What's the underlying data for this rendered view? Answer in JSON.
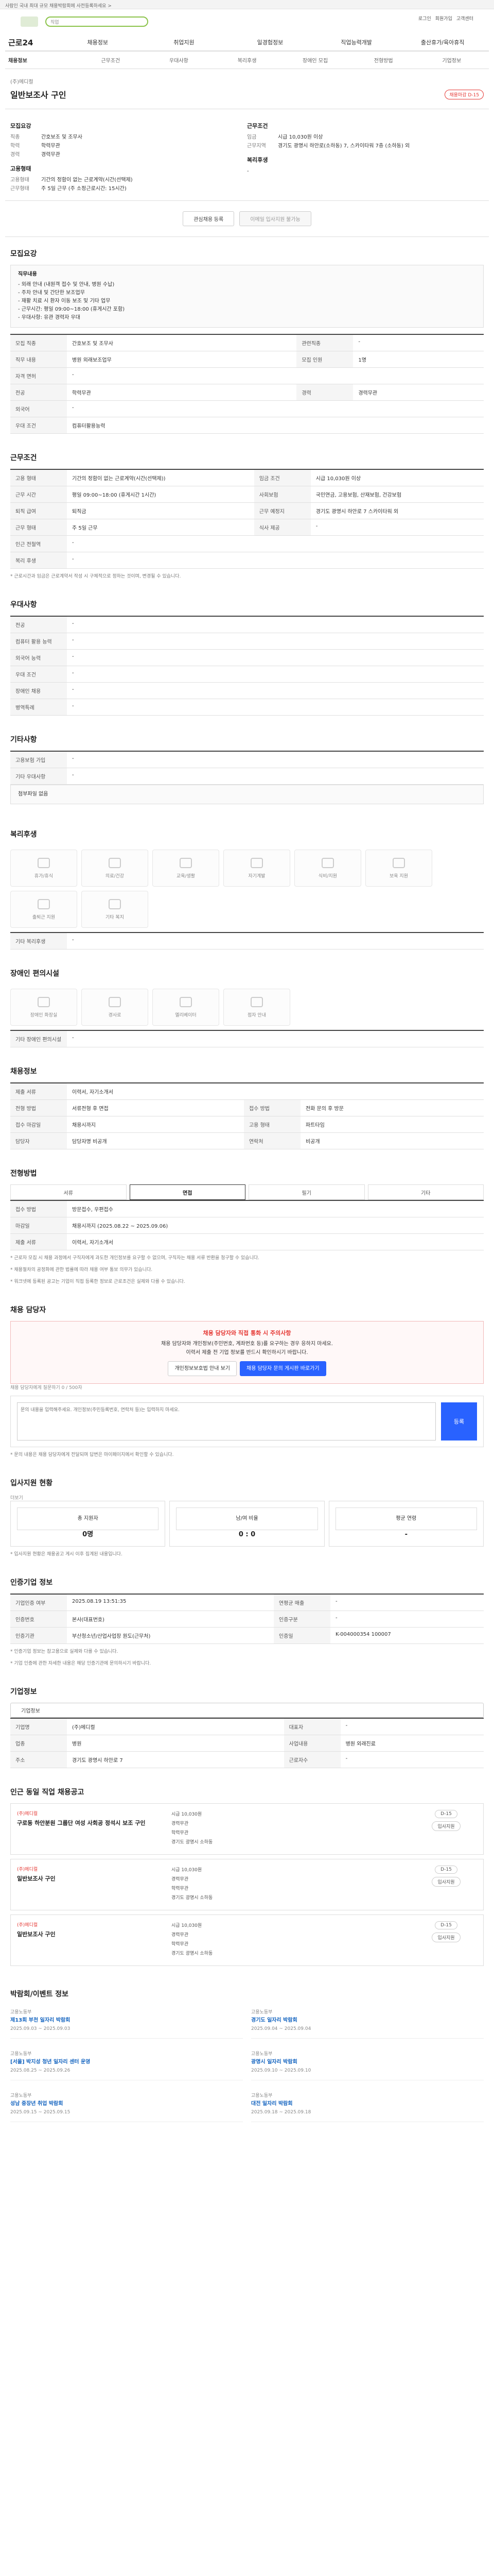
{
  "topbar": {
    "notice": "사람인 국내 최대 규모 채용박람회에 사전등록하세요 >"
  },
  "search": {
    "placeholder": "직업",
    "util": [
      "로그인",
      "회원가입",
      "고객센터"
    ]
  },
  "gnb": {
    "brand": "근로24",
    "items": [
      "채용정보",
      "취업지원",
      "일경험정보",
      "직업능력개발",
      "출산휴가/육아휴직"
    ]
  },
  "tabs": [
    "채용정보",
    "근무조건",
    "우대사항",
    "복리후생",
    "장애인 모집",
    "전형방법",
    "기업정보"
  ],
  "job": {
    "company": "(주)메디컬",
    "title": "일반보조사 구인",
    "dday": "채용마감 D-15"
  },
  "recruit": {
    "heading": "모집요강",
    "items": [
      {
        "k": "직종",
        "v": "간호보조 및 조무사"
      },
      {
        "k": "학력",
        "v": "학력무관"
      },
      {
        "k": "경력",
        "v": "경력무관"
      }
    ]
  },
  "cond": {
    "heading": "근무조건",
    "items": [
      {
        "k": "임금",
        "v": "시급 10,030원 이상"
      },
      {
        "k": "근무지역",
        "v": "경기도 광명시 하안로(소하동) 7, 스카이타워 7층 (소하동) 외"
      }
    ]
  },
  "employ": {
    "heading": "고용형태",
    "items": [
      {
        "k": "고용형태",
        "v": "기간의 정함이 없는 근로계약(시간(선택제)"
      },
      {
        "k": "근무형태",
        "v": "주 5일 근무 (주 소정근로시간: 15시간)"
      }
    ]
  },
  "welfare_top": {
    "heading": "복리후생",
    "v": "-"
  },
  "buttons": {
    "scrap": "관심채용 등록",
    "apply": "이메일 입사지원 불가능"
  },
  "s1": {
    "heading": "모집요강",
    "box_title": "직무내용",
    "box_lines": [
      "- 외래 안내 (내원객 접수 및 안내, 병원 수납)",
      "- 주차 안내 및 간단한 보조업무",
      "- 재활 치료 시 환자 이동 보조 및 기타 업무",
      "- 근무시간: 평일 09:00~18:00 (휴게시간 포함)",
      "- 우대사항: 유관 경력자 우대"
    ],
    "rows": [
      [
        "모집 직종",
        "간호보조 및 조무사",
        "관련직종",
        "-"
      ],
      [
        "직무 내용",
        "병원 외래보조업무",
        "모집 인원",
        "1명"
      ],
      [
        "자격 면허",
        "-",
        "",
        ""
      ],
      [
        "전공",
        "학력무관",
        "경력",
        "경력무관"
      ],
      [
        "외국어",
        "-",
        "",
        ""
      ],
      [
        "우대 조건",
        "컴퓨터활용능력",
        "",
        ""
      ]
    ]
  },
  "s2": {
    "heading": "근무조건",
    "rows": [
      [
        "고용 형태",
        "기간의 정함이 없는 근로계약(시간(선택제))",
        "임금 조건",
        "시급 10,030원 이상"
      ],
      [
        "근무 시간",
        "평일 09:00~18:00 (휴게시간 1시간)",
        "사회보험",
        "국민연금, 고용보험, 산재보험, 건강보험"
      ],
      [
        "퇴직 급여",
        "퇴직금",
        "근무 예정지",
        "경기도 광명시 하안로 7 스카이타워 외"
      ],
      [
        "근무 형태",
        "주 5일 근무",
        "식사 제공",
        "-"
      ],
      [
        "인근 전철역",
        "-",
        "",
        ""
      ],
      [
        "복리 후생",
        "-",
        "",
        ""
      ]
    ],
    "note": "* 근로시간과 임금은 근로계약서 작성 시 구체적으로 정하는 것이며, 변경될 수 있습니다."
  },
  "s3": {
    "heading": "우대사항",
    "rows": [
      [
        "전공",
        "-"
      ],
      [
        "컴퓨터 활용 능력",
        "-"
      ],
      [
        "외국어 능력",
        "-"
      ],
      [
        "우대 조건",
        "-"
      ],
      [
        "장애인 채용",
        "-"
      ],
      [
        "병역특례",
        "-"
      ]
    ]
  },
  "s4": {
    "heading": "기타사항",
    "rows": [
      [
        "고용보험 가입",
        "-"
      ],
      [
        "기타 우대사항",
        "-"
      ]
    ],
    "file": "첨부파일 없음"
  },
  "s5": {
    "heading": "복리후생",
    "icons": [
      "휴가/휴식",
      "의료/건강",
      "교육/생활",
      "자기계발",
      "식비/지원",
      "보육 지원",
      "출퇴근 지원",
      "기타 복지"
    ],
    "etc_label": "기타 복리후생",
    "etc": "-"
  },
  "s6": {
    "heading": "장애인 편의시설",
    "icons": [
      "장애인 화장실",
      "경사로",
      "엘리베이터",
      "점자 안내"
    ],
    "etc_label": "기타 장애인 편의시설",
    "etc": "-"
  },
  "s7": {
    "heading": "채용정보",
    "rows": [
      [
        "제출 서류",
        "이력서, 자기소개서",
        "",
        ""
      ],
      [
        "전형 방법",
        "서류전형 후 면접",
        "접수 방법",
        "전화 문의 후 방문"
      ],
      [
        "접수 마감일",
        "채용시까지",
        "고용 형태",
        "파트타임"
      ],
      [
        "담당자",
        "담당자명 비공개",
        "연락처",
        "비공개"
      ]
    ]
  },
  "s8": {
    "heading": "전형방법",
    "options": [
      "서류",
      "면접",
      "필기",
      "기타"
    ],
    "selected": 1,
    "meth_label": "접수 방법",
    "meth": "방문접수, 우편접수",
    "period_label": "마감일",
    "period": "채용시까지 (2025.08.22 ~ 2025.09.06)",
    "docs_label": "제출 서류",
    "docs": "이력서, 자기소개서",
    "notes": [
      "* 근로자 모집 시 채용 과정에서 구직자에게 과도한 개인정보를 요구할 수 없으며, 구직자는 채용 서류 반환을 청구할 수 있습니다.",
      "* 채용절차의 공정화에 관한 법률에 따라 채용 여부 통보 의무가 있습니다.",
      "* 워크넷에 등록된 공고는 기업이 직접 등록한 정보로 근로조건은 실제와 다를 수 있습니다."
    ]
  },
  "s9": {
    "heading": "채용 담당자",
    "alert_h": "채용 담당자와 직접 통화 시 주의사항",
    "alert": [
      "채용 담당자와 개인정보(주민번호, 계좌번호 등)를 요구하는 경우 응하지 마세요.",
      "이력서 제출 전 기업 정보를 반드시 확인하시기 바랍니다."
    ],
    "b1": "개인정보보호법 안내 보기",
    "b2": "채용 담당자 문의 게시판 바로가기",
    "inq_label": "채용 담당자에게 질문하기",
    "inq_limit": "0 / 500자",
    "inq_ph": "문의 내용을 입력해주세요. 개인정보(주민등록번호, 연락처 등)는 입력하지 마세요.",
    "send": "등록",
    "inq_note": "* 문의 내용은 채용 담당자에게 전달되며 답변은 마이페이지에서 확인할 수 있습니다."
  },
  "s10": {
    "heading": "입사지원 현황",
    "more": "더보기",
    "stats": [
      {
        "l": "총 지원자",
        "v": "0명"
      },
      {
        "l": "남/여 비율",
        "v": "0 : 0"
      },
      {
        "l": "평균 연령",
        "v": "-"
      }
    ],
    "note": "* 입사지원 현황은 채용공고 게시 이후 집계된 내용입니다."
  },
  "s11": {
    "heading": "인증기업 정보",
    "rows": [
      [
        "기업인증 여부",
        "2025.08.19 13:51:35",
        "연평균 매출",
        "-"
      ],
      [
        "인증번호",
        "본사(대표번호)",
        "인증구분",
        "-"
      ],
      [
        "인증기관",
        "부산청소년/산업사업장 원도(근무처)",
        "인증일",
        "K-004000354 100007"
      ]
    ],
    "notes": [
      "* 인증기업 정보는 참고용으로 실제와 다를 수 있습니다.",
      "* 기업 인증에 관한 자세한 내용은 해당 인증기관에 문의하시기 바랍니다."
    ]
  },
  "s12": {
    "heading": "기업정보",
    "btn": "기업정보",
    "rows": [
      [
        "기업명",
        "(주)메디컬",
        "대표자",
        "-"
      ],
      [
        "업종",
        "병원",
        "사업내용",
        "병원 외래진료"
      ],
      [
        "주소",
        "경기도 광명시 하안로 7",
        "근로자수",
        "-"
      ]
    ]
  },
  "s13": {
    "heading": "인근 동일 직업 채용공고",
    "recs": [
      {
        "c": "(주)메디컬",
        "n": "구로동 하안분원 그룹단 여성 사회공 정석시 보조 구인",
        "meta": [
          "시급 10,030원",
          "경력무관",
          "학력무관",
          "경기도 광명시 소하동"
        ],
        "d": "D-15"
      },
      {
        "c": "(주)메디컬",
        "n": "일반보조사 구인",
        "meta": [
          "시급 10,030원",
          "경력무관",
          "학력무관",
          "경기도 광명시 소하동"
        ],
        "d": "D-15"
      },
      {
        "c": "(주)메디컬",
        "n": "일반보조사 구인",
        "meta": [
          "시급 10,030원",
          "경력무관",
          "학력무관",
          "경기도 광명시 소하동"
        ],
        "d": "D-15"
      }
    ],
    "btn": "입사지원"
  },
  "s14": {
    "heading": "박람회/이벤트 정보",
    "items": [
      {
        "a": "고용노동부",
        "t": "제13회 부천 일자리 박람회",
        "d": "2025.09.03 ~ 2025.09.03"
      },
      {
        "a": "고용노동부",
        "t": "경기도 일자리 박람회",
        "d": "2025.09.04 ~ 2025.09.04"
      },
      {
        "a": "고용노동부",
        "t": "[서울] 박지성 청년 일자리 센터 운영",
        "d": "2025.08.25 ~ 2025.09.26"
      },
      {
        "a": "고용노동부",
        "t": "광명시 일자리 박람회",
        "d": "2025.09.10 ~ 2025.09.10"
      },
      {
        "a": "고용노동부",
        "t": "성남 중장년 취업 박람회",
        "d": "2025.09.15 ~ 2025.09.15"
      },
      {
        "a": "고용노동부",
        "t": "대전 일자리 박람회",
        "d": "2025.09.18 ~ 2025.09.18"
      }
    ]
  }
}
